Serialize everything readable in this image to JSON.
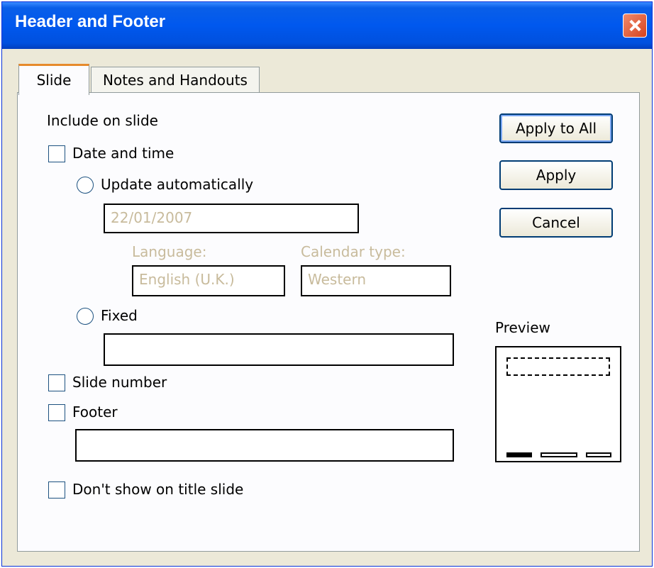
{
  "window": {
    "title": "Header and Footer"
  },
  "tabs": [
    {
      "label": "Slide"
    },
    {
      "label": "Notes and Handouts"
    }
  ],
  "include": {
    "heading": "Include on slide",
    "date_time": {
      "label": "Date and time",
      "checked": false
    },
    "update_auto": {
      "label": "Update automatically",
      "selected": false
    },
    "date_value": "22/01/2007",
    "language": {
      "label": "Language:",
      "value": "English (U.K.)"
    },
    "calendar": {
      "label": "Calendar type:",
      "value": "Western"
    },
    "fixed": {
      "label": "Fixed",
      "selected": false,
      "value": ""
    },
    "slide_number": {
      "label": "Slide number",
      "checked": false
    },
    "footer": {
      "label": "Footer",
      "checked": false,
      "value": ""
    },
    "dont_show_title": {
      "label": "Don't show on title slide",
      "checked": false
    }
  },
  "buttons": {
    "apply_all": "Apply to All",
    "apply": "Apply",
    "cancel": "Cancel"
  },
  "preview": {
    "label": "Preview"
  }
}
